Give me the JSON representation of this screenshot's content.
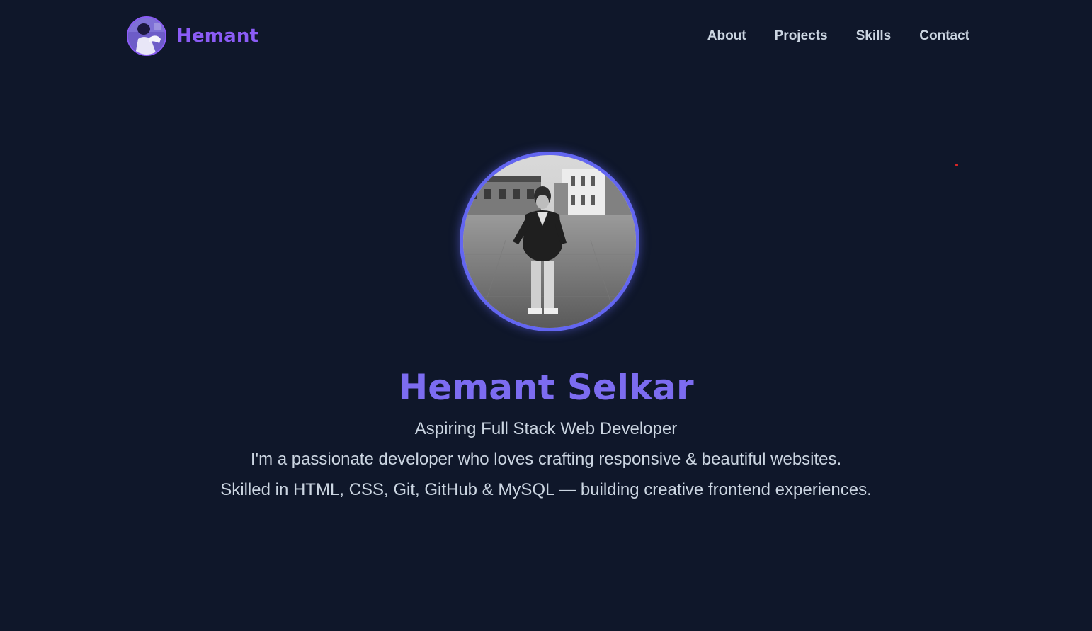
{
  "header": {
    "brand_name": "Hemant",
    "nav": [
      {
        "label": "About"
      },
      {
        "label": "Projects"
      },
      {
        "label": "Skills"
      },
      {
        "label": "Contact"
      }
    ]
  },
  "hero": {
    "name": "Hemant Selkar",
    "role": "Aspiring Full Stack Web Developer",
    "desc1": "I'm a passionate developer who loves crafting responsive & beautiful websites.",
    "desc2": "Skilled in HTML, CSS, Git, GitHub & MySQL — building creative frontend experiences."
  },
  "colors": {
    "background": "#0f172a",
    "accent": "#8b5cf6",
    "ring": "#6366f1",
    "text": "#cbd5e1"
  }
}
